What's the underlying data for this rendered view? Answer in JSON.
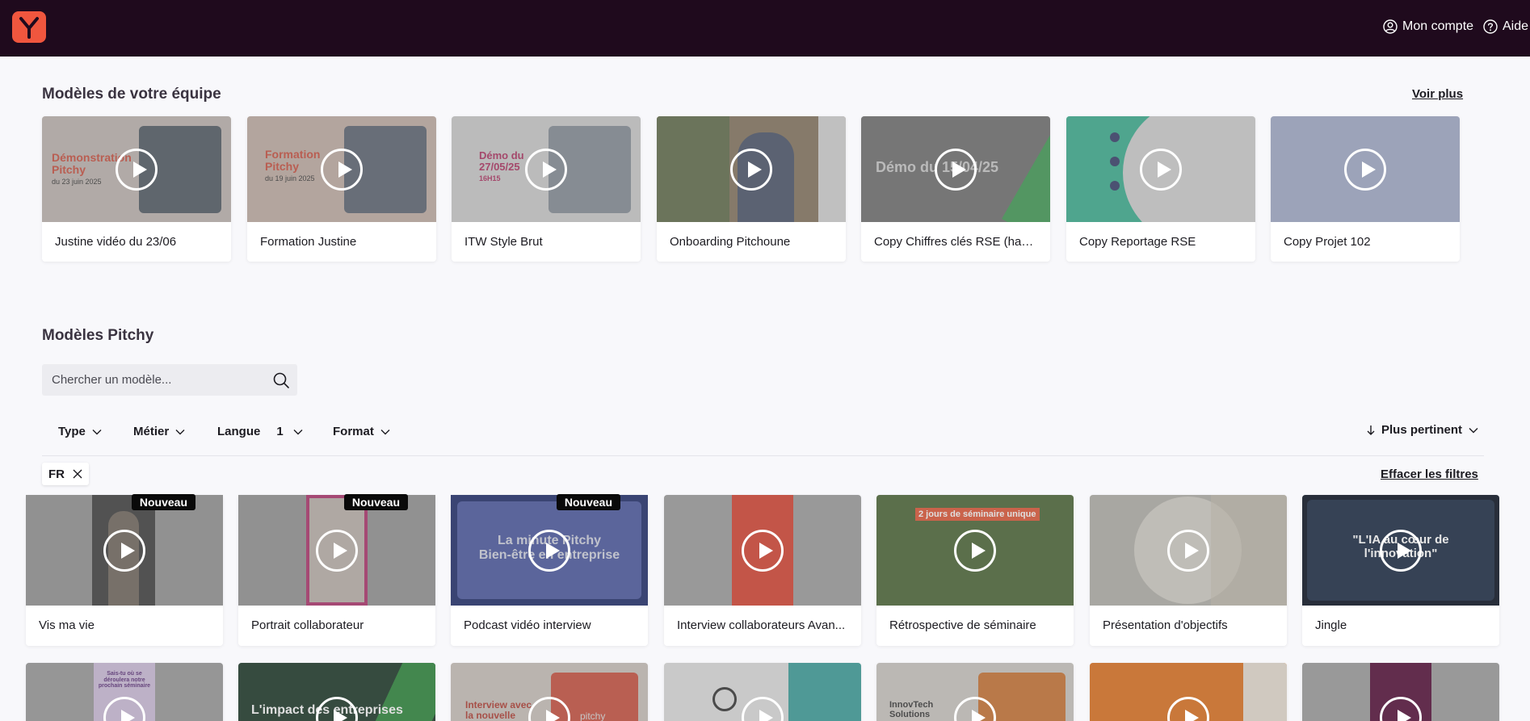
{
  "header": {
    "account_label": "Mon compte",
    "help_label": "Aide"
  },
  "team": {
    "title": "Modèles de votre équipe",
    "see_more": "Voir plus",
    "cards": [
      {
        "title": "Justine vidéo du 23/06",
        "thumb_lines": [
          "Démonstration",
          "Pitchy"
        ],
        "thumb_sub": "du 23 juin 2025"
      },
      {
        "title": "Formation Justine",
        "thumb_lines": [
          "Formation",
          "Pitchy"
        ],
        "thumb_sub": "du 19 juin 2025"
      },
      {
        "title": "ITW Style Brut",
        "thumb_lines": [
          "Démo du",
          "27/05/25"
        ],
        "thumb_sub": "16H15"
      },
      {
        "title": "Onboarding Pitchoune"
      },
      {
        "title": "Copy Chiffres clés RSE (habi...",
        "thumb_lines": [
          "Démo du 15/04/25"
        ]
      },
      {
        "title": "Copy Reportage RSE"
      },
      {
        "title": "Copy Projet 102"
      }
    ]
  },
  "pitchy": {
    "title": "Modèles Pitchy",
    "search_placeholder": "Chercher un modèle...",
    "filters": {
      "type": "Type",
      "metier": "Métier",
      "langue": "Langue",
      "langue_count": "1",
      "format": "Format"
    },
    "sort_label": "Plus pertinent",
    "active_chip": "FR",
    "clear_filters": "Effacer les filtres",
    "badge_label": "Nouveau",
    "cards": [
      {
        "title": "Vis ma vie",
        "new": true
      },
      {
        "title": "Portrait collaborateur",
        "new": true
      },
      {
        "title": "Podcast vidéo interview",
        "new": true,
        "thumb_lines": [
          "La minute Pitchy",
          "Bien-être en entreprise"
        ]
      },
      {
        "title": "Interview collaborateurs Avan..."
      },
      {
        "title": "Rétrospective de séminaire",
        "thumb_lines": [
          "2 jours de séminaire unique"
        ]
      },
      {
        "title": "Présentation d'objectifs"
      },
      {
        "title": "Jingle",
        "thumb_lines": [
          "\"L'IA au cœur de",
          "l'innovation\""
        ]
      }
    ],
    "row2": [
      {
        "thumb_lines": [
          "Sais-tu où se",
          "déroulera notre",
          "prochain séminaire"
        ]
      },
      {
        "thumb_lines": [
          "L'impact des entreprises"
        ]
      },
      {
        "thumb_lines": [
          "Interview avec",
          "la nouvelle"
        ],
        "thumb_sub": "pitchy"
      },
      {},
      {
        "thumb_lines": [
          "InnovTech",
          "Solutions"
        ]
      },
      {},
      {}
    ]
  },
  "colors": {
    "topbar": "#1f0a1d",
    "brand": "#f0563e"
  }
}
